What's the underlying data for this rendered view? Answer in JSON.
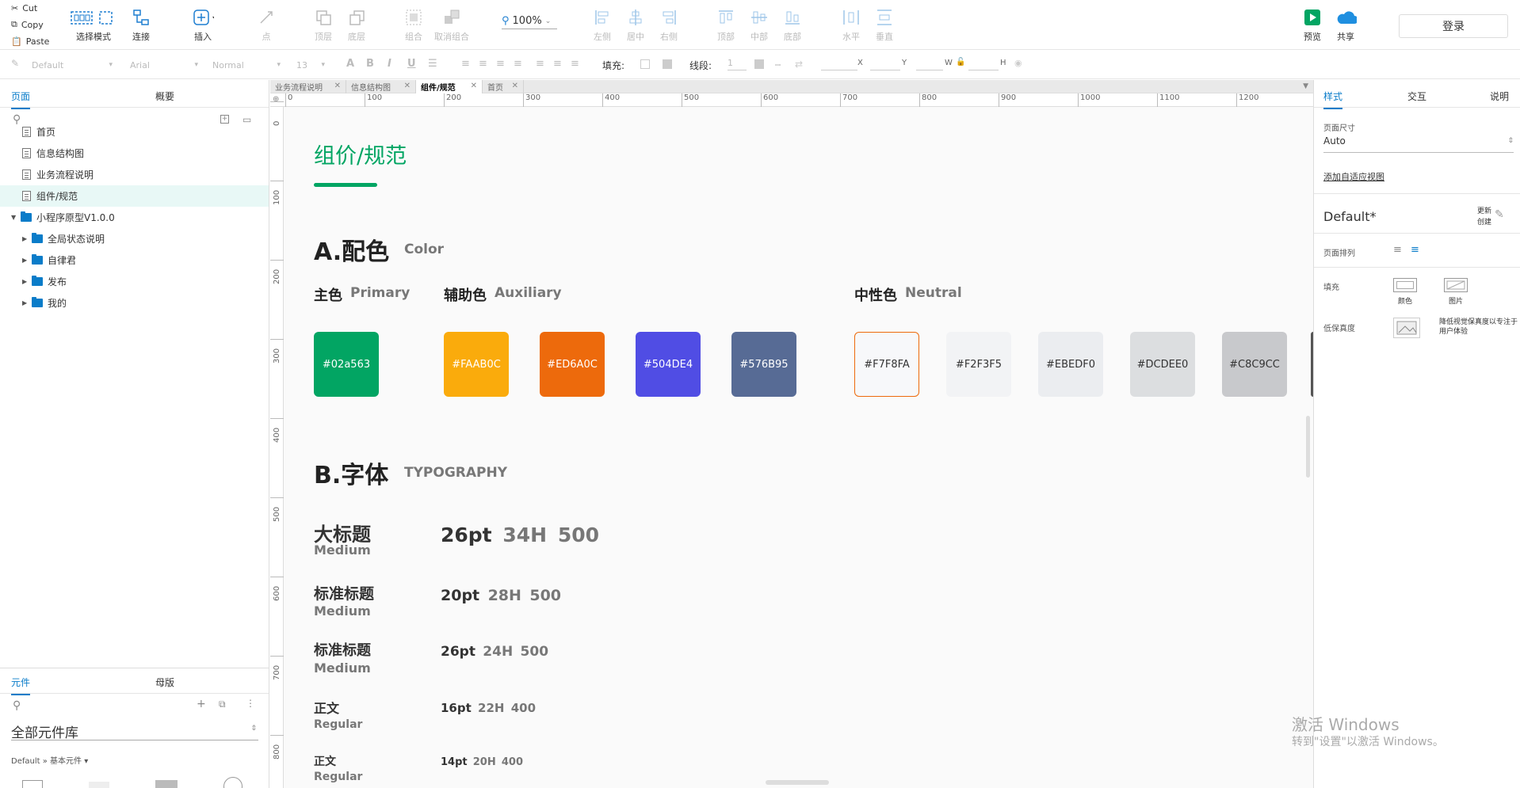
{
  "toolbar": {
    "clipboard": {
      "cut": "Cut",
      "copy": "Copy",
      "paste": "Paste"
    },
    "select_mode": "选择模式",
    "connect": "连接",
    "insert": "插入",
    "point": "点",
    "top_layer": "顶层",
    "bottom_layer": "底层",
    "group": "组合",
    "ungroup": "取消组合",
    "zoom": "100%",
    "align_left": "左侧",
    "align_center": "居中",
    "align_right": "右侧",
    "align_top": "顶部",
    "align_middle": "中部",
    "align_bottom": "底部",
    "dist_h": "水平",
    "dist_v": "垂直",
    "preview": "预览",
    "share": "共享",
    "login": "登录"
  },
  "format_bar": {
    "style": "Default",
    "font": "Arial",
    "weight": "Normal",
    "size": "13",
    "fill_label": "填充:",
    "stroke_label": "线段:",
    "stroke_value": "1",
    "x_label": "X",
    "y_label": "Y",
    "w_label": "W",
    "h_label": "H"
  },
  "left_panel": {
    "tab_pages": "页面",
    "tab_outline": "概要",
    "pages": [
      {
        "label": "首页"
      },
      {
        "label": "信息结构图"
      },
      {
        "label": "业务流程说明"
      },
      {
        "label": "组件/规范"
      }
    ],
    "folder_root": "小程序原型V1.0.0",
    "folders": [
      {
        "label": "全局状态说明"
      },
      {
        "label": "自律君"
      },
      {
        "label": "发布"
      },
      {
        "label": "我的"
      }
    ],
    "tab_widgets": "元件",
    "tab_masters": "母版",
    "library": "全部元件库",
    "library_sub": "Default » 基本元件 ▾"
  },
  "doc_tabs": [
    {
      "label": "业务流程说明"
    },
    {
      "label": "信息结构图"
    },
    {
      "label": "组件/规范"
    },
    {
      "label": "首页"
    }
  ],
  "ruler": {
    "h": [
      "0",
      "100",
      "200",
      "300",
      "400",
      "500",
      "600",
      "700",
      "800",
      "900",
      "1000",
      "1100",
      "1200"
    ],
    "v": [
      "0",
      "100",
      "200",
      "300",
      "400",
      "500",
      "600",
      "700",
      "800"
    ]
  },
  "canvas": {
    "page_title": "组价/规范",
    "accent": "#02a563",
    "section_a": {
      "title": "A.配色",
      "sub": "Color"
    },
    "primary": {
      "title": "主色",
      "sub": "Primary"
    },
    "auxiliary": {
      "title": "辅助色",
      "sub": "Auxiliary"
    },
    "neutral": {
      "title": "中性色",
      "sub": "Neutral"
    },
    "swatches_primary": [
      {
        "hex": "#02a563",
        "label": "#02a563"
      }
    ],
    "swatches_aux": [
      {
        "hex": "#FAAB0C",
        "label": "#FAAB0C"
      },
      {
        "hex": "#ED6A0C",
        "label": "#ED6A0C"
      },
      {
        "hex": "#504DE4",
        "label": "#504DE4"
      },
      {
        "hex": "#576B95",
        "label": "#576B95"
      }
    ],
    "swatches_neutral": [
      {
        "hex": "#F7F8FA",
        "label": "#F7F8FA"
      },
      {
        "hex": "#F2F3F5",
        "label": "#F2F3F5"
      },
      {
        "hex": "#EBEDF0",
        "label": "#EBEDF0"
      },
      {
        "hex": "#DCDEE0",
        "label": "#DCDEE0"
      },
      {
        "hex": "#C8C9CC",
        "label": "#C8C9CC"
      }
    ],
    "section_b": {
      "title": "B.字体",
      "sub": "TYPOGRAPHY"
    },
    "typography": [
      {
        "name": "大标题",
        "weight": "Medium",
        "size": "26pt",
        "height": "34H",
        "w": "500"
      },
      {
        "name": "标准标题",
        "weight": "Medium",
        "size": "20pt",
        "height": "28H",
        "w": "500"
      },
      {
        "name": "标准标题",
        "weight": "Medium",
        "size": "26pt",
        "height": "24H",
        "w": "500"
      },
      {
        "name": "正文",
        "weight": "Regular",
        "size": "16pt",
        "height": "22H",
        "w": "400"
      },
      {
        "name": "正文",
        "weight": "Regular",
        "size": "14pt",
        "height": "20H",
        "w": "400"
      }
    ]
  },
  "right_panel": {
    "tab_style": "样式",
    "tab_interact": "交互",
    "tab_notes": "说明",
    "page_size_label": "页面尺寸",
    "page_size_value": "Auto",
    "adaptive_link": "添加自适应视图",
    "style_name": "Default*",
    "update_label": "更新",
    "create_label": "创建",
    "page_align_label": "页面排列",
    "fill_label": "填充",
    "fill_color": "颜色",
    "fill_image": "图片",
    "lowfi_label": "低保真度",
    "lowfi_desc": "降低视觉保真度以专注于用户体验"
  },
  "watermark": {
    "line1": "激活 Windows",
    "line2": "转到\"设置\"以激活 Windows。"
  }
}
